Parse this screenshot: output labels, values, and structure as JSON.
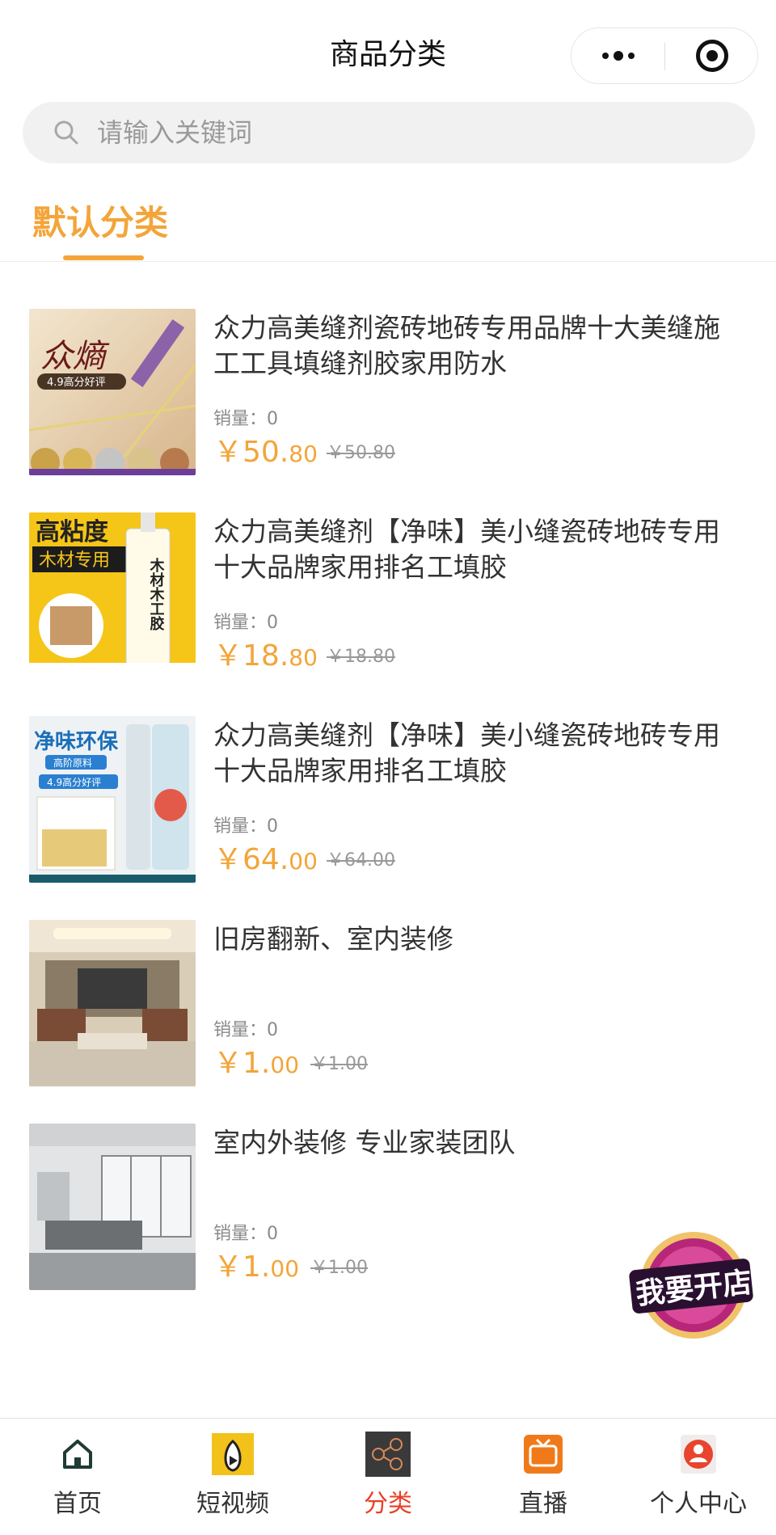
{
  "navbar": {
    "title": "商品分类"
  },
  "search": {
    "placeholder": "请输入关键词"
  },
  "category_tabs": [
    {
      "label": "默认分类",
      "active": true
    }
  ],
  "products": [
    {
      "title": "众力高美缝剂瓷砖地砖专用品牌十大美缝施工工具填缝剂胶家用防水",
      "sales_label": "销量：0",
      "price_symbol": "￥",
      "price_int": "50.",
      "price_dec": "80",
      "original_price": "￥50.80",
      "thumb_text": [
        "众熵",
        "4.9高分好评"
      ]
    },
    {
      "title": "众力高美缝剂【净味】美小缝瓷砖地砖专用十大品牌家用排名工填胶",
      "sales_label": "销量：0",
      "price_symbol": "￥",
      "price_int": "18.",
      "price_dec": "80",
      "original_price": "￥18.80",
      "thumb_text": [
        "高粘度",
        "木材专用",
        "木材木工胶"
      ]
    },
    {
      "title": "众力高美缝剂【净味】美小缝瓷砖地砖专用十大品牌家用排名工填胶",
      "sales_label": "销量：0",
      "price_symbol": "￥",
      "price_int": "64.",
      "price_dec": "00",
      "original_price": "￥64.00",
      "thumb_text": [
        "净味环保",
        "高阶原料",
        "4.9高分好评"
      ]
    },
    {
      "title": "旧房翻新、室内装修",
      "sales_label": "销量：0",
      "price_symbol": "￥",
      "price_int": "1.",
      "price_dec": "00",
      "original_price": "￥1.00",
      "thumb_text": []
    },
    {
      "title": "室内外装修 专业家装团队",
      "sales_label": "销量：0",
      "price_symbol": "￥",
      "price_int": "1.",
      "price_dec": "00",
      "original_price": "￥1.00",
      "thumb_text": []
    }
  ],
  "floating_badge": {
    "text": "我要开店"
  },
  "tabbar": [
    {
      "label": "首页",
      "icon": "home-icon",
      "active": false
    },
    {
      "label": "短视频",
      "icon": "short-video-icon",
      "active": false
    },
    {
      "label": "分类",
      "icon": "category-icon",
      "active": true
    },
    {
      "label": "直播",
      "icon": "live-tv-icon",
      "active": false
    },
    {
      "label": "个人中心",
      "icon": "user-center-icon",
      "active": false
    }
  ],
  "colors": {
    "accent": "#f3a53a",
    "tab_active": "#ea3f25"
  }
}
